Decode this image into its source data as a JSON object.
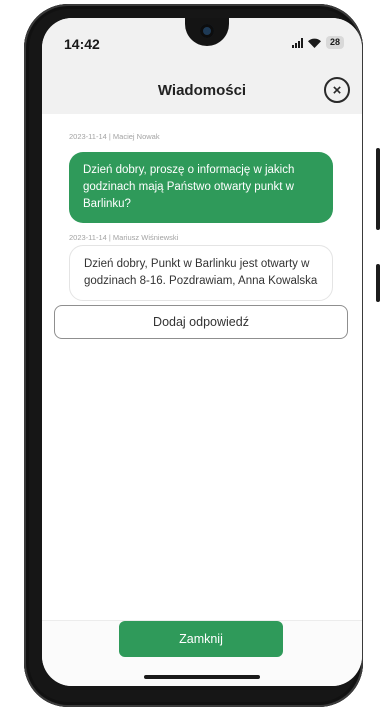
{
  "status_bar": {
    "time": "14:42",
    "battery": "28",
    "icons": [
      "signal-icon",
      "wifi-icon",
      "battery-icon"
    ]
  },
  "header": {
    "title": "Wiadomości",
    "close_icon": "close-circle-icon"
  },
  "messages": [
    {
      "meta": "2023-11-14 | Maciej Nowak",
      "text": "Dzień dobry, proszę o informację w jakich godzinach mają Państwo otwarty punkt w Barlinku?",
      "sender": "me"
    },
    {
      "meta": "2023-11-14 | Mariusz Wiśniewski",
      "text": "Dzień dobry, Punkt w Barlinku jest otwarty w godzinach 8-16. Pozdrawiam, Anna Kowalska",
      "sender": "other"
    }
  ],
  "actions": {
    "reply_label": "Dodaj odpowiedź",
    "close_label": "Zamknij"
  },
  "colors": {
    "accent": "#2f9a5a",
    "header_bg": "#f1f1f1"
  }
}
